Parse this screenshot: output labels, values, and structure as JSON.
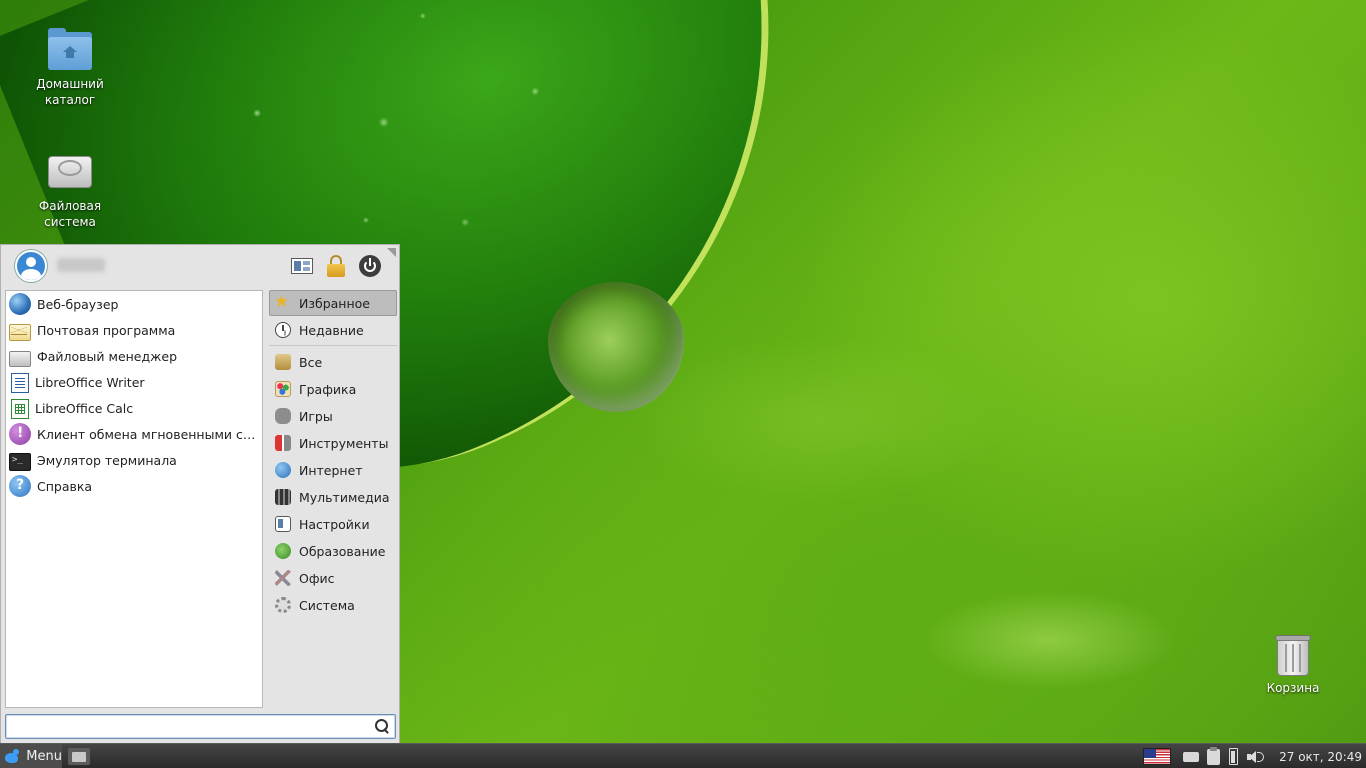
{
  "desktop": {
    "icons": [
      {
        "label": "Домашний каталог"
      },
      {
        "label": "Файловая система"
      },
      {
        "label": "Корзина"
      }
    ]
  },
  "menu": {
    "username": "rollerit",
    "apps": [
      {
        "label": "Веб-браузер",
        "icon": "web-browser-icon"
      },
      {
        "label": "Почтовая программа",
        "icon": "mail-icon"
      },
      {
        "label": "Файловый менеджер",
        "icon": "file-manager-icon"
      },
      {
        "label": "LibreOffice Writer",
        "icon": "writer-icon"
      },
      {
        "label": "LibreOffice Calc",
        "icon": "calc-icon"
      },
      {
        "label": "Клиент обмена мгновенными сообщениями",
        "icon": "messenger-icon"
      },
      {
        "label": "Эмулятор терминала",
        "icon": "terminal-icon"
      },
      {
        "label": "Справка",
        "icon": "help-icon"
      }
    ],
    "categories_top": [
      {
        "label": "Избранное",
        "icon": "star-icon",
        "active": true
      },
      {
        "label": "Недавние",
        "icon": "clock-icon",
        "active": false
      }
    ],
    "categories": [
      {
        "label": "Все",
        "icon": "all-apps-icon"
      },
      {
        "label": "Графика",
        "icon": "graphics-icon"
      },
      {
        "label": "Игры",
        "icon": "games-icon"
      },
      {
        "label": "Инструменты",
        "icon": "tools-icon"
      },
      {
        "label": "Интернет",
        "icon": "internet-icon"
      },
      {
        "label": "Мультимедиа",
        "icon": "multimedia-icon"
      },
      {
        "label": "Настройки",
        "icon": "settings-icon"
      },
      {
        "label": "Образование",
        "icon": "education-icon"
      },
      {
        "label": "Офис",
        "icon": "office-icon"
      },
      {
        "label": "Система",
        "icon": "system-icon"
      }
    ],
    "search": {
      "value": "",
      "placeholder": ""
    }
  },
  "taskbar": {
    "menu_label": "Menu",
    "clock": "27 окт, 20:49"
  }
}
